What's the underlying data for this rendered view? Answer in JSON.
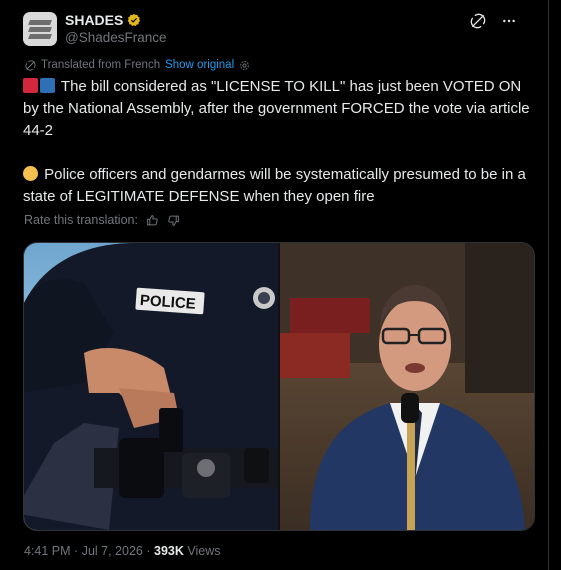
{
  "author": {
    "name": "SHADES",
    "handle": "@ShadesFrance"
  },
  "translation": {
    "note": "Translated from French",
    "show_original": "Show original"
  },
  "tweet": {
    "para1": "The bill considered as \"LICENSE TO KILL\" has just been VOTED ON by the National Assembly, after the government FORCED the vote via article 44-2",
    "para2": "Police officers and gendarmes will be systematically presumed to be in a state of LEGITIMATE DEFENSE when they open fire"
  },
  "rate": {
    "label": "Rate this translation:"
  },
  "media": {
    "left_patch": "POLICE"
  },
  "meta": {
    "time": "4:41 PM",
    "sep1": "·",
    "date": "Jul 7, 2026",
    "sep2": "·",
    "views_count": "393K",
    "views_label": "Views"
  },
  "icons": [
    "grok-icon",
    "more-icon",
    "translate-icon",
    "settings-icon",
    "thumbs-up-icon",
    "thumbs-down-icon",
    "verified-badge-icon"
  ],
  "colors": {
    "accent": "#1d9bf0",
    "verified": "#e2b719",
    "text": "#e7e9ea",
    "muted": "#71767b"
  }
}
